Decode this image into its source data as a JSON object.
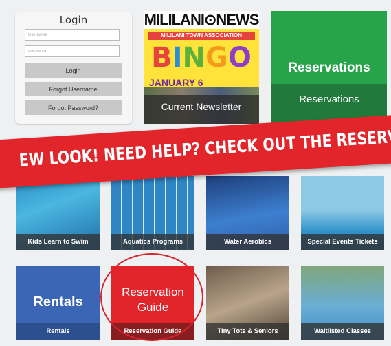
{
  "login": {
    "title": "Login",
    "username_placeholder": "Username",
    "password_placeholder": "Password",
    "login_button": "Login",
    "forgot_username_button": "Forgot Username",
    "forgot_password_button": "Forgot Password?"
  },
  "newsletter": {
    "logo_text": "MILILANI⊙NEWS",
    "assoc_text": "MILILANI TOWN ASSOCIATION",
    "bingo_letters": [
      "B",
      "I",
      "N",
      "G",
      "O"
    ],
    "date": "JANUARY 6",
    "caption": "Current Newsletter"
  },
  "reservations_tile": {
    "title": "Reservations",
    "caption": "Reservations",
    "color": "#27a44a"
  },
  "banner": {
    "text": "EW LOOK! NEED HELP? CHECK OUT THE RESERVATION GUIDE!",
    "color": "#e1252a"
  },
  "tiles_row1": [
    {
      "caption": "Kids Learn to Swim"
    },
    {
      "caption": "Aquatics Programs"
    },
    {
      "caption": "Water Aerobics"
    },
    {
      "caption": "Special Events Tickets"
    }
  ],
  "tiles_row2": [
    {
      "title": "Rentals",
      "caption": "Rentals",
      "color": "#3b66b5"
    },
    {
      "title_line1": "Reservation",
      "title_line2": "Guide",
      "caption": "Reservation Guide",
      "color": "#e1252a"
    },
    {
      "caption": "Tiny Tots & Seniors"
    },
    {
      "caption": "Waitlisted Classes"
    }
  ]
}
